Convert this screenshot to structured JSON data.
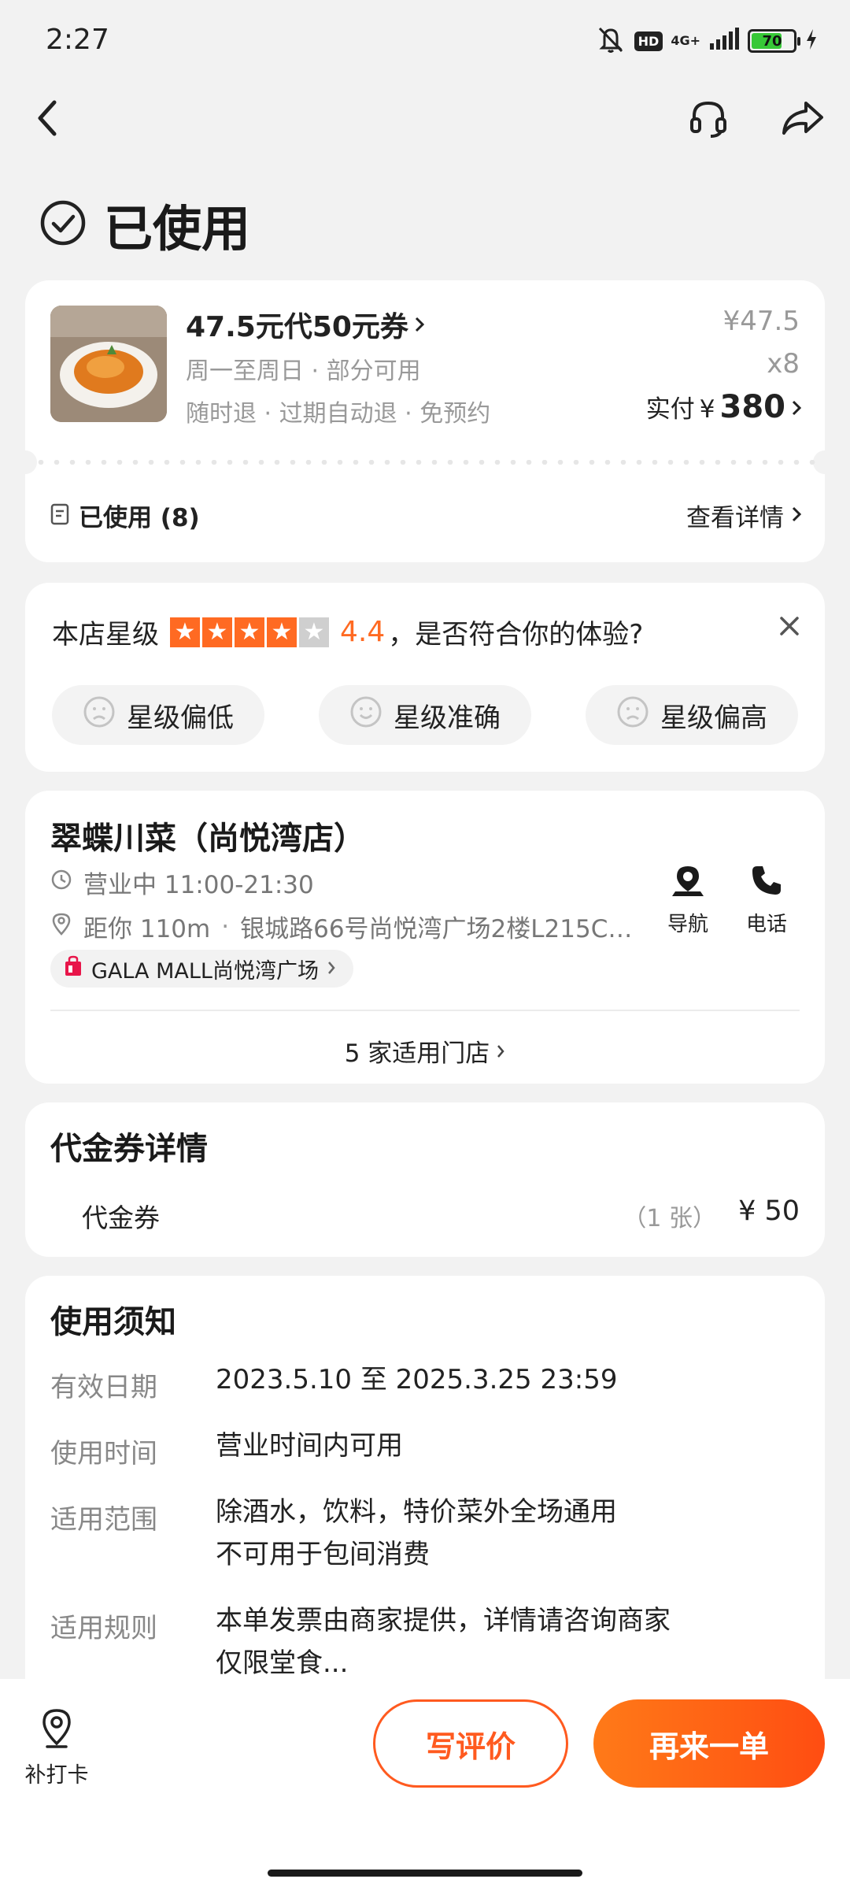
{
  "status_bar": {
    "time": "2:27",
    "hd": "HD",
    "network": "4G+",
    "battery_level": "70",
    "battery_percent": 70
  },
  "page": {
    "status_title": "已使用"
  },
  "coupon": {
    "title": "47.5元代50元券",
    "line2": "周一至周日 · 部分可用",
    "line3": "随时退 · 过期自动退 · 免预约",
    "unit_price": "¥47.5",
    "quantity": "x8",
    "paid_label": "实付",
    "paid_currency": "¥",
    "paid_amount": "380",
    "used_label": "已使用 (8)",
    "details_link": "查看详情"
  },
  "rating": {
    "label": "本店星级",
    "score": "4.4",
    "stars": 4.4,
    "question": "，是否符合你的体验?",
    "options": [
      "星级偏低",
      "星级准确",
      "星级偏高"
    ]
  },
  "store": {
    "name": "翠蝶川菜（尚悦湾店）",
    "hours": "营业中 11:00-21:30",
    "distance": "距你 110m",
    "address": "银城路66号尚悦湾广场2楼L215C…",
    "mall": "GALA MALL尚悦湾广场",
    "nav_label": "导航",
    "phone_label": "电话",
    "stores_link": "5 家适用门店"
  },
  "voucher_details": {
    "heading": "代金券详情",
    "item_name": "代金券",
    "item_count": "（1 张）",
    "item_price": "¥ 50"
  },
  "usage_notes": {
    "heading": "使用须知",
    "rows": [
      {
        "label": "有效日期",
        "value": "2023.5.10 至 2025.3.25 23:59"
      },
      {
        "label": "使用时间",
        "value": "营业时间内可用"
      },
      {
        "label": "适用范围",
        "value": "除酒水，饮料，特价菜外全场通用",
        "value2": "不可用于包间消费"
      },
      {
        "label": "适用规则",
        "value": "本单发票由商家提供，详情请咨询商家",
        "value2": "仅限堂食..."
      }
    ]
  },
  "bottom": {
    "checkin_label": "补打卡",
    "review_button": "写评价",
    "reorder_button": "再来一单"
  },
  "colors": {
    "accent": "#ff5a1f",
    "background": "#f2f2f2",
    "card": "#ffffff"
  }
}
